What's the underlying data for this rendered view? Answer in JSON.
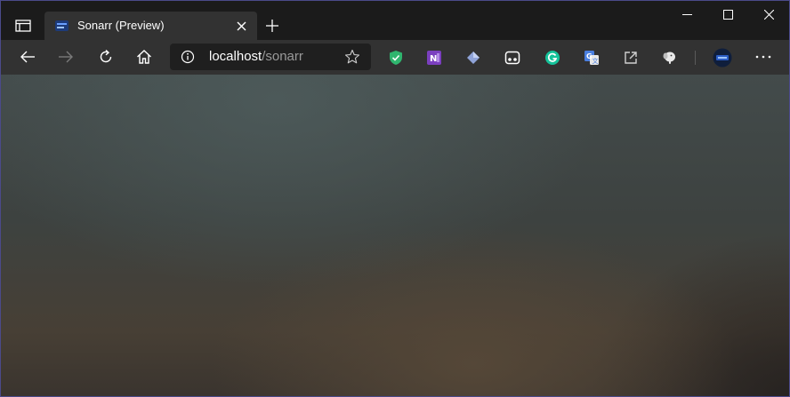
{
  "window": {
    "controls": {
      "minimize_icon": "minimize-icon",
      "maximize_icon": "maximize-icon",
      "close_icon": "close-icon"
    }
  },
  "tabs": [
    {
      "title": "Sonarr (Preview)",
      "favicon": "sonarr-favicon",
      "active": true
    }
  ],
  "toolbar": {
    "back_icon": "back-arrow-icon",
    "forward_icon": "forward-arrow-icon",
    "refresh_icon": "refresh-icon",
    "home_icon": "home-icon"
  },
  "address": {
    "host": "localhost",
    "path": "/sonarr",
    "info_icon": "info-icon",
    "favorite_icon": "star-icon"
  },
  "extensions": [
    {
      "name": "shield-extension-icon",
      "color": "#2fb56e"
    },
    {
      "name": "onenote-extension-icon",
      "color": "#7b3fbf"
    },
    {
      "name": "diamond-extension-icon",
      "color": "#8fa3d8"
    },
    {
      "name": "mask-extension-icon",
      "color": "#ffffff"
    },
    {
      "name": "grammarly-extension-icon",
      "color": "#15c39a"
    },
    {
      "name": "translate-extension-icon",
      "color": "#4a7fe0"
    },
    {
      "name": "share-extension-icon",
      "color": "#d0d0d0"
    },
    {
      "name": "elephant-extension-icon",
      "color": "#e8e8e8"
    }
  ],
  "profile": {
    "icon": "profile-avatar-icon"
  },
  "menu": {
    "icon": "more-options-icon"
  },
  "colors": {
    "frame_border": "#4b4a8a",
    "titlebar": "#1b1b1b",
    "toolbar": "#323232",
    "address_bg": "#1f1f1f"
  }
}
